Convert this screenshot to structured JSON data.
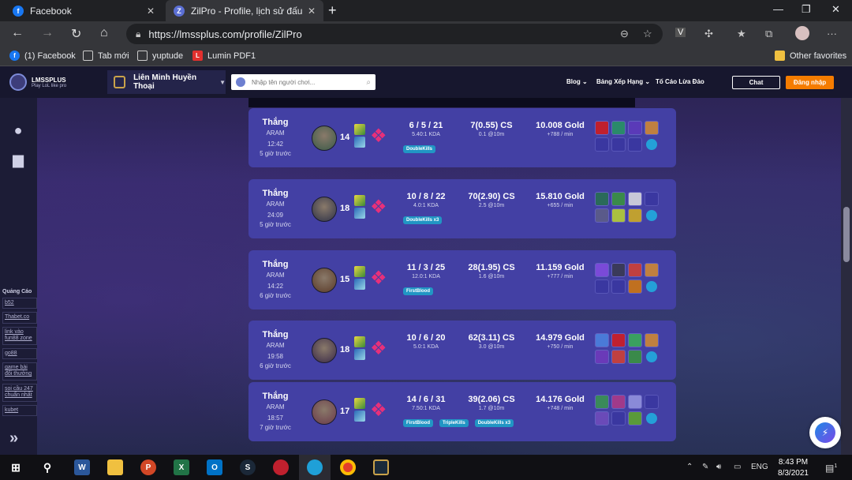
{
  "browser": {
    "tabs": [
      {
        "label": "Facebook",
        "active": false
      },
      {
        "label": "ZilPro - Profile, lịch sử đấu",
        "active": true
      }
    ],
    "url": "https://lmssplus.com/profile/ZilPro",
    "bookmarks": [
      "(1) Facebook",
      "Tab mới",
      "yuptude",
      "Lumin PDF1"
    ],
    "other_favorites": "Other favorites",
    "profile_letter": "V"
  },
  "site": {
    "logo_title": "LMSSPLUS",
    "logo_sub": "Play LoL like pro",
    "game": "Liên Minh Huyền Thoại",
    "search_placeholder": "Nhập tên người chơi...",
    "nav": {
      "blog": "Blog",
      "ranking": "Bảng Xếp Hạng",
      "report": "Tố Cáo Lừa Đảo"
    },
    "chat": "Chat",
    "login": "Đăng nhập",
    "ads": {
      "title": "Quảng Cáo",
      "links": [
        "b52",
        "Thabet.co",
        "link vào fun88 zone",
        "go88",
        "game bài đổi thưởng",
        "soi cầu 247 chuẩn nhất",
        "kubet"
      ]
    }
  },
  "matches": [
    {
      "result": "Thắng",
      "mode": "ARAM",
      "duration": "12:42",
      "ago": "5 giờ trước",
      "level": "14",
      "kda": "6 / 5 / 21",
      "kda_ratio": "5.40:1 KDA",
      "cs": "7(0.55) CS",
      "cs10": "0.1 @10m",
      "gold": "10.008 Gold",
      "gold_min": "+788 / min",
      "tags": [
        "DoubleKills"
      ]
    },
    {
      "result": "Thắng",
      "mode": "ARAM",
      "duration": "24:09",
      "ago": "5 giờ trước",
      "level": "18",
      "kda": "10 / 8 / 22",
      "kda_ratio": "4.0:1 KDA",
      "cs": "70(2.90) CS",
      "cs10": "2.5 @10m",
      "gold": "15.810 Gold",
      "gold_min": "+655 / min",
      "tags": [
        "DoubleKills x3"
      ]
    },
    {
      "result": "Thắng",
      "mode": "ARAM",
      "duration": "14:22",
      "ago": "6 giờ trước",
      "level": "15",
      "kda": "11 / 3 / 25",
      "kda_ratio": "12.0:1 KDA",
      "cs": "28(1.95) CS",
      "cs10": "1.6 @10m",
      "gold": "11.159 Gold",
      "gold_min": "+777 / min",
      "tags": [
        "FirstBlood"
      ]
    },
    {
      "result": "Thắng",
      "mode": "ARAM",
      "duration": "19:58",
      "ago": "6 giờ trước",
      "level": "18",
      "kda": "10 / 6 / 20",
      "kda_ratio": "5.0:1 KDA",
      "cs": "62(3.11) CS",
      "cs10": "3.0 @10m",
      "gold": "14.979 Gold",
      "gold_min": "+750 / min",
      "tags": []
    },
    {
      "result": "Thắng",
      "mode": "ARAM",
      "duration": "18:57",
      "ago": "7 giờ trước",
      "level": "17",
      "kda": "14 / 6 / 31",
      "kda_ratio": "7.50:1 KDA",
      "cs": "39(2.06) CS",
      "cs10": "1.7 @10m",
      "gold": "14.176 Gold",
      "gold_min": "+748 / min",
      "tags": [
        "FirstBlood",
        "TripleKills",
        "DoubleKills x3"
      ]
    }
  ],
  "taskbar": {
    "lang": "ENG",
    "time": "8:43 PM",
    "date": "8/3/2021",
    "notifications": "1"
  }
}
